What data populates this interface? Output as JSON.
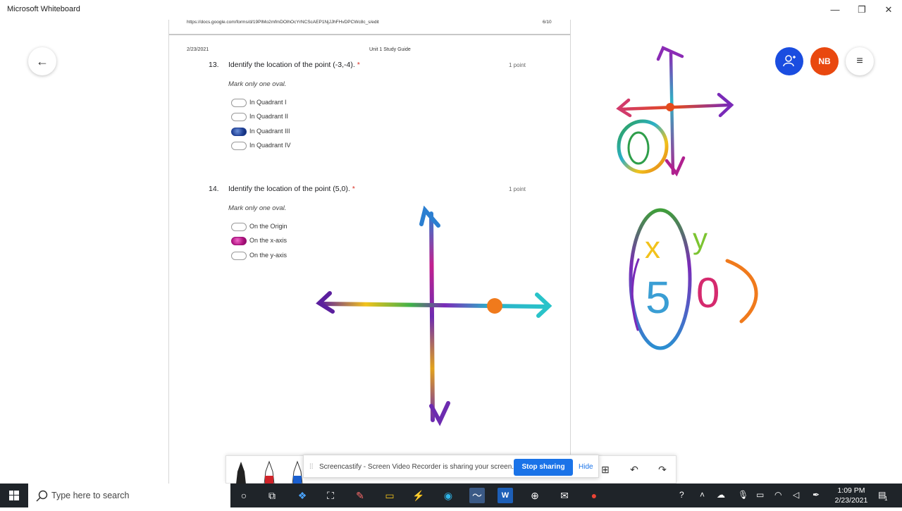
{
  "window": {
    "title": "Microsoft Whiteboard",
    "minimize": "—",
    "maximize": "❐",
    "close": "✕"
  },
  "doc": {
    "url": "https://docs.google.com/forms/d/19PlMo2mfmDOlhOcYrNCScAEP1NjJJhFHvDPCWc8c_s/edit",
    "page": "6/10",
    "date": "2/23/2021",
    "guide_title": "Unit 1 Study Guide",
    "questions": [
      {
        "number": "13.",
        "text": "Identify the location of the point (-3,-4).",
        "required": "*",
        "points": "1 point",
        "instruction": "Mark only one oval.",
        "options": [
          "In Quadrant I",
          "In Quadrant II",
          "In Quadrant III",
          "In Quadrant IV"
        ],
        "selected": 2
      },
      {
        "number": "14.",
        "text": "Identify the location of the point (5,0).",
        "required": "*",
        "points": "1 point",
        "instruction": "Mark only one oval.",
        "options": [
          "On the Origin",
          "On the x-axis",
          "On the y-axis"
        ],
        "selected": 1
      }
    ]
  },
  "ink": {
    "label_x": "x",
    "label_y": "y",
    "label_5": "5",
    "label_0": "0"
  },
  "buttons": {
    "back": "←",
    "profile_initials": "NB",
    "menu": "≡"
  },
  "sharebar": {
    "grip": "⁞⁞",
    "text": "Screencastify - Screen Video Recorder is sharing your screen.",
    "stop": "Stop sharing",
    "hide": "Hide"
  },
  "toolbar": {
    "add": "⊞",
    "undo": "↶",
    "redo": "↷"
  },
  "taskbar": {
    "search_placeholder": "Type here to search",
    "time": "1:09 PM",
    "date": "2/23/2021",
    "notification_count": "1"
  },
  "colors": {
    "accent_blue": "#1a73e8",
    "profile_orange": "#e9480f",
    "person_blue": "#1a4de0",
    "taskbar": "#1f2429"
  }
}
